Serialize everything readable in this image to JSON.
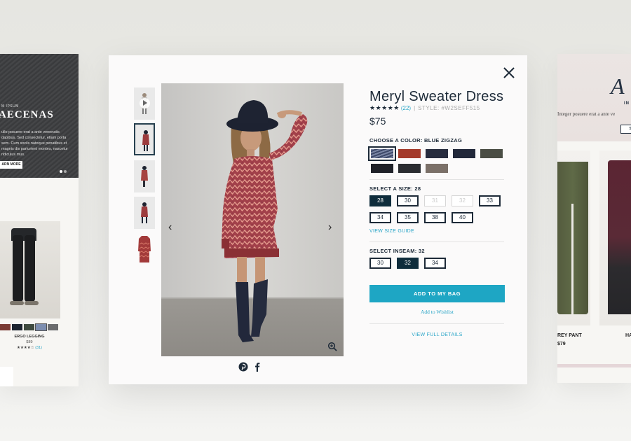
{
  "left_card": {
    "kicker": "M IPSUM",
    "title": "AECENAS",
    "body": "ullo posuere erat a ante venenatis dapibus. Sed consectetur, etiam porta sem. Cum sociis natoque penatibus et magnis dis parturient montes, nascetur ridiculus mus.",
    "button": "ARN MORE",
    "product_name": "ERGO LEGGING",
    "product_price": "$89",
    "product_stars": "★★★★☆",
    "product_reviews": "(31)",
    "swatches": [
      "#7a3a34",
      "#1d2430",
      "#3f4a3f",
      "#7d8eb0",
      "#6a6b6d"
    ]
  },
  "right_card": {
    "script_title": "A",
    "kicker": "IN",
    "body": "Integer posuere erat a ante ve",
    "button": "SH",
    "product1_name": "REY PANT",
    "product1_price": "$79",
    "product2_name": "HA"
  },
  "modal": {
    "title": "Meryl Sweater Dress",
    "stars": "★★★★★",
    "review_count": "(22)",
    "separator": "|",
    "style_label": "STYLE: #W2SEFF515",
    "price": "$75",
    "color_label": "CHOOSE A COLOR: BLUE ZIGZAG",
    "colors": [
      "#5a6686",
      "#a33a2a",
      "#272c3e",
      "#22283a",
      "#4a4d44",
      "#1f2128",
      "#2a2c30",
      "#7b7068"
    ],
    "size_label": "SELECT A SIZE: 28",
    "sizes": [
      "28",
      "30",
      "31",
      "32",
      "33",
      "34",
      "35",
      "38",
      "40"
    ],
    "size_guide": "VIEW SIZE GUIDE",
    "inseam_label": "SELECT INSEAM: 32",
    "inseams": [
      "30",
      "32",
      "34"
    ],
    "add_to_bag": "ADD TO MY BAG",
    "wishlist": "Add to Wishlist",
    "full_details": "VIEW FULL DETAILS",
    "icons": {
      "close": "close-icon",
      "prev": "chevron-left-icon",
      "next": "chevron-right-icon",
      "zoom": "zoom-in-icon",
      "pinterest": "pinterest-icon",
      "facebook": "facebook-icon",
      "play": "play-icon"
    },
    "accent": "#1ea6c4",
    "navy": "#0f2d3c",
    "prev_arrow": "‹",
    "next_arrow": "›"
  }
}
